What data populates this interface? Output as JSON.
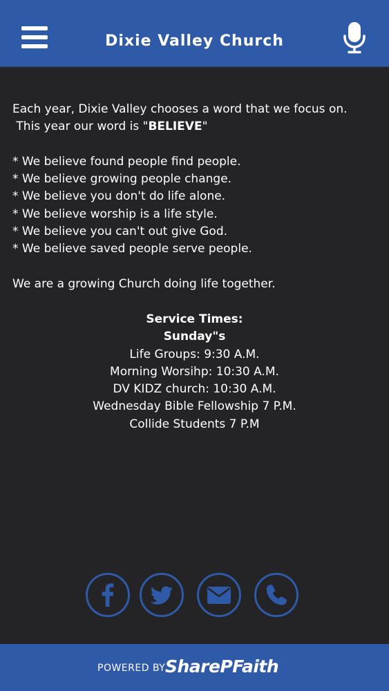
{
  "header": {
    "title": "Dixie Valley Church",
    "menu_icon": "hamburger-menu-icon",
    "mic_icon": "microphone-icon",
    "background_color": "#2f5aa8"
  },
  "content": {
    "intro_line1": "Each year, Dixie Valley chooses a word that we focus on.",
    "intro_line2_prefix": " This year our word is \"",
    "intro_word": "BELIEVE",
    "intro_line2_suffix": "\"",
    "beliefs": [
      "* We believe found people find people.",
      "* We believe growing people change.",
      "* We believe you don't do life alone.",
      "* We believe worship is a life style.",
      "* We believe you can't out give God.",
      "* We believe saved people serve people."
    ],
    "closing": "We are a growing Church doing life together."
  },
  "service_times": {
    "heading": "Service Times:",
    "day": "Sunday\"s",
    "items": [
      "Life Groups: 9:30 A.M.",
      "Morning Worsihp: 10:30 A.M.",
      "DV KIDZ church: 10:30 A.M.",
      "Wednesday Bible Fellowship 7 P.M.",
      "Collide Students 7 P.M"
    ]
  },
  "social": {
    "buttons": [
      {
        "icon": "facebook-icon"
      },
      {
        "icon": "twitter-icon"
      },
      {
        "icon": "email-icon"
      },
      {
        "icon": "phone-icon"
      }
    ],
    "color": "#2f5aa8"
  },
  "footer": {
    "powered_by": "POWERED BY",
    "brand": "SharePFaith"
  }
}
